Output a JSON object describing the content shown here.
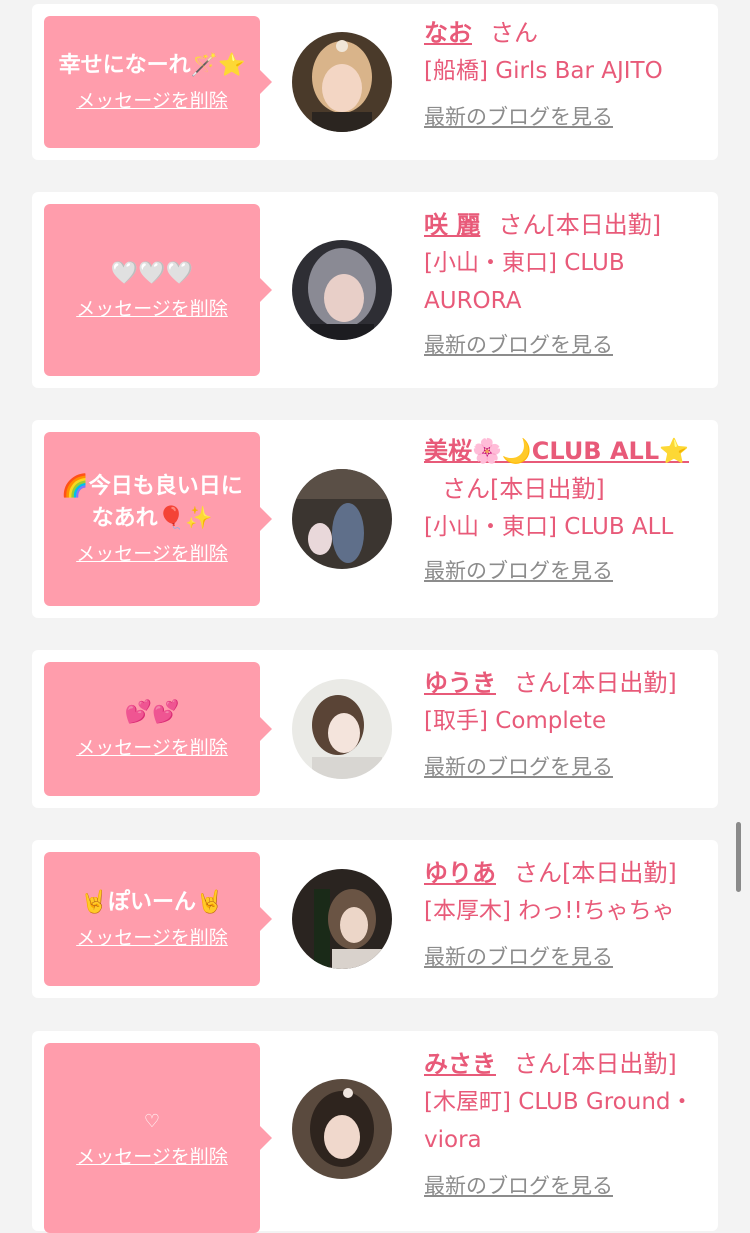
{
  "colors": {
    "page_bg": "#f3f3f3",
    "card_bg": "#ffffff",
    "bubble_bg": "#ff9dac",
    "accent": "#e85a79",
    "link_gray": "#8c8c8c"
  },
  "cards": [
    {
      "message": "幸せになーれ🪄⭐️",
      "delete_label": "メッセージを削除",
      "name": "なお",
      "honorific": "さん",
      "status": "",
      "shop": "[船橋] Girls Bar AJITO",
      "blog_link": "最新のブログを見る"
    },
    {
      "message": "🤍🤍🤍",
      "delete_label": "メッセージを削除",
      "name": "咲 麗",
      "honorific": "さん",
      "status": "[本日出勤]",
      "shop": "[小山・東口] CLUB AURORA",
      "blog_link": "最新のブログを見る"
    },
    {
      "message": "🌈今日も良い日になあれ🎈✨",
      "delete_label": "メッセージを削除",
      "name": "美桜🌸🌙CLUB ALL⭐️",
      "honorific": "さん",
      "status": "[本日出勤]",
      "shop": "[小山・東口] CLUB ALL",
      "blog_link": "最新のブログを見る"
    },
    {
      "message": "💕💕",
      "delete_label": "メッセージを削除",
      "name": "ゆうき",
      "honorific": "さん",
      "status": "[本日出勤]",
      "shop": "[取手] Complete",
      "blog_link": "最新のブログを見る"
    },
    {
      "message": "🤘ぽいーん🤘",
      "delete_label": "メッセージを削除",
      "name": "ゆりあ",
      "honorific": "さん",
      "status": "[本日出勤]",
      "shop": "[本厚木] わっ!!ちゃちゃ",
      "blog_link": "最新のブログを見る"
    },
    {
      "message": "♡",
      "delete_label": "メッセージを削除",
      "name": "みさき",
      "honorific": "さん",
      "status": "[本日出勤]",
      "shop": "[木屋町] CLUB Ground・viora",
      "blog_link": "最新のブログを見る"
    }
  ]
}
